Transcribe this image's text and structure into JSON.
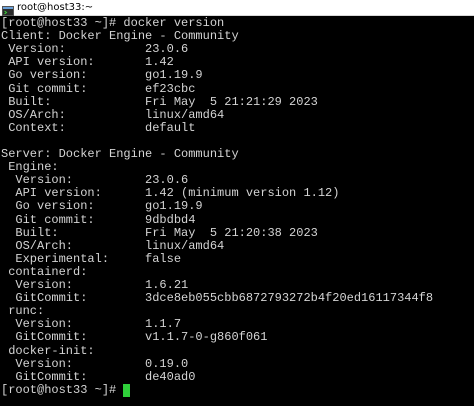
{
  "window": {
    "title": "root@host33:~"
  },
  "terminal": {
    "lines": [
      "[root@host33 ~]# docker version",
      "Client: Docker Engine - Community",
      " Version:           23.0.6",
      " API version:       1.42",
      " Go version:        go1.19.9",
      " Git commit:        ef23cbc",
      " Built:             Fri May  5 21:21:29 2023",
      " OS/Arch:           linux/amd64",
      " Context:           default",
      "",
      "Server: Docker Engine - Community",
      " Engine:",
      "  Version:          23.0.6",
      "  API version:      1.42 (minimum version 1.12)",
      "  Go version:       go1.19.9",
      "  Git commit:       9dbdbd4",
      "  Built:            Fri May  5 21:20:38 2023",
      "  OS/Arch:          linux/amd64",
      "  Experimental:     false",
      " containerd:",
      "  Version:          1.6.21",
      "  GitCommit:        3dce8eb055cbb6872793272b4f20ed16117344f8",
      " runc:",
      "  Version:          1.1.7",
      "  GitCommit:        v1.1.7-0-g860f061",
      " docker-init:",
      "  Version:          0.19.0",
      "  GitCommit:        de40ad0"
    ],
    "prompt": "[root@host33 ~]# "
  },
  "colors": {
    "background": "#000000",
    "foreground": "#d4d4d4",
    "cursor": "#2fd03a",
    "titlebar": "#ffffff"
  },
  "icons": {
    "app": "terminal-app-icon"
  }
}
